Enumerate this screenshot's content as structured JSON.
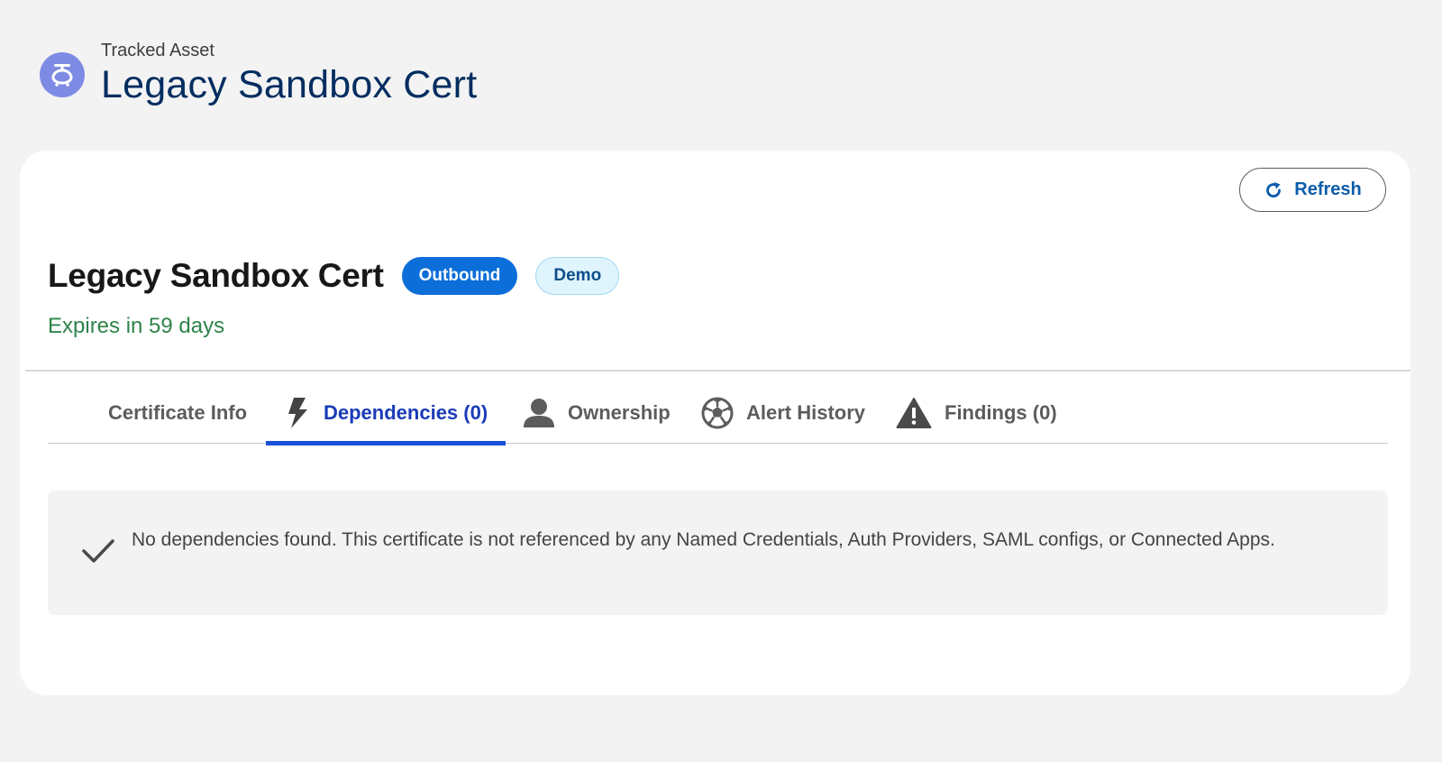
{
  "header": {
    "eyebrow": "Tracked Asset",
    "title": "Legacy Sandbox Cert",
    "icon": "tracked-asset-icon"
  },
  "toolbar": {
    "refresh_label": "Refresh",
    "refresh_icon": "refresh-icon"
  },
  "record": {
    "title": "Legacy Sandbox Cert",
    "badges": [
      "Outbound",
      "Demo"
    ],
    "expiry": "Expires in 59 days"
  },
  "tabs": [
    {
      "label": "Certificate Info",
      "icon": null,
      "active": false
    },
    {
      "label": "Dependencies (0)",
      "icon": "lightning-bolt-icon",
      "active": true
    },
    {
      "label": "Ownership",
      "icon": "user-icon",
      "active": false
    },
    {
      "label": "Alert History",
      "icon": "soccer-ball-icon",
      "active": false
    },
    {
      "label": "Findings (0)",
      "icon": "warning-icon",
      "active": false
    }
  ],
  "empty_state": {
    "icon": "checkmark-icon",
    "message": "No dependencies found. This certificate is not referenced by any Named Credentials, Auth Providers, SAML configs, or Connected Apps."
  },
  "colors": {
    "page_title": "#032d60",
    "accent_icon": "#7e8be4",
    "refresh_text": "#0b5cab",
    "badge_outbound": "#0b6ed9",
    "badge_demo_bg": "#e0f4fd",
    "expiry_text": "#2e844a",
    "active_tab": "#1a3bb7"
  }
}
